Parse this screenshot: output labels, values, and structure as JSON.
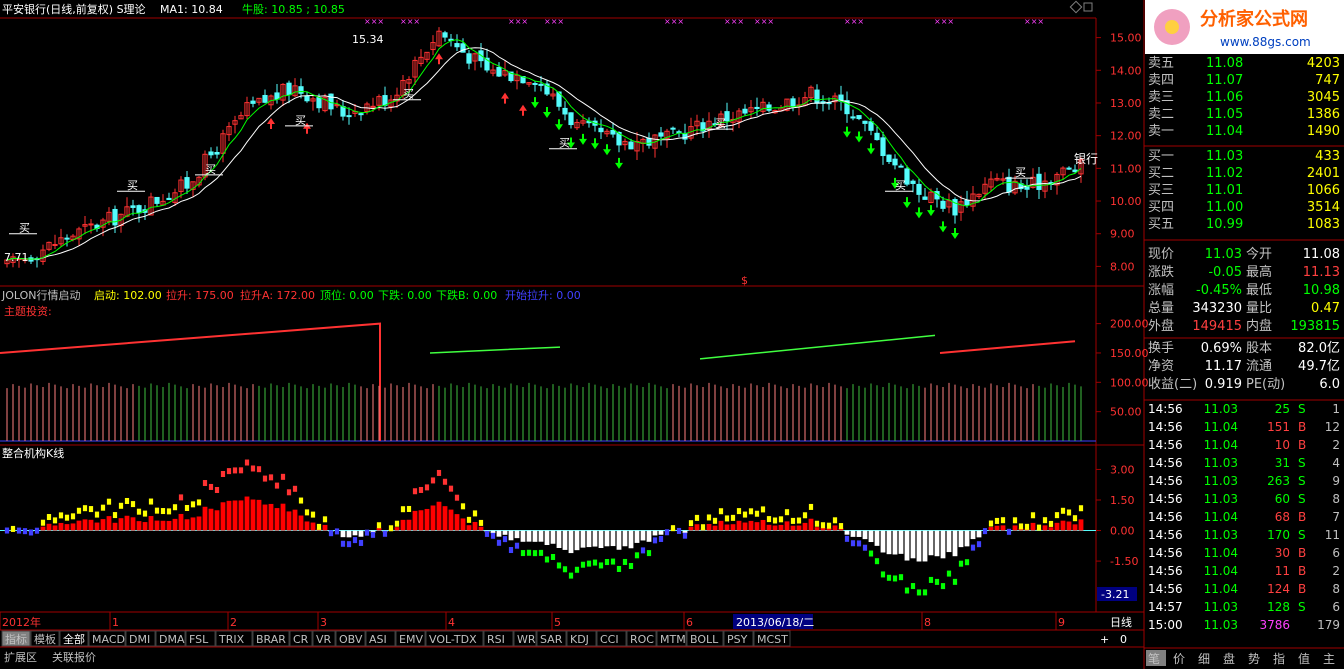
{
  "header": {
    "stock_title": "平安银行(日线,前复权) S理论",
    "ma1_label": "MA1: 10.84",
    "bull_label": "牛股: 10.85 ; 10.85"
  },
  "panel_main": {
    "yticks": [
      "15.00",
      "14.00",
      "13.00",
      "12.00",
      "11.00",
      "10.00",
      "9.00",
      "8.00"
    ],
    "high_mark": "15.34",
    "low_mark": "7.71",
    "buy_text": "买",
    "bank_label": "银行"
  },
  "panel_jolon": {
    "title": "JOLON行情启动",
    "start": "启动: 102.00",
    "rise": "拉升: 175.00",
    "riseA": "拉升A: 172.00",
    "top": "顶位: 0.00",
    "drop": "下跌: 0.00",
    "dropB": "下跌B: 0.00",
    "begin_rise": "开始拉升: 0.00",
    "theme": "主题投资:",
    "yticks": [
      "200.00",
      "150.00",
      "100.00",
      "50.00"
    ]
  },
  "panel_k": {
    "title": "整合机构K线",
    "yticks": [
      "3.00",
      "1.50",
      "0.00",
      "-1.50"
    ],
    "last_value": "-3.21"
  },
  "xaxis": {
    "labels": [
      "2012年",
      "1",
      "2",
      "3",
      "4",
      "5",
      "6",
      "8",
      "9"
    ],
    "date_marker": "2013/06/18/二",
    "period": "日线"
  },
  "tabs": [
    "指标",
    "模板",
    "全部",
    "MACD",
    "DMI",
    "DMA",
    "FSL",
    "TRIX",
    "BRAR",
    "CR",
    "VR",
    "OBV",
    "ASI",
    "EMV",
    "VOL-TDX",
    "RSI",
    "WR",
    "SAR",
    "KDJ",
    "CCI",
    "ROC",
    "MTM",
    "BOLL",
    "PSY",
    "MCST"
  ],
  "tabs2": [
    "扩展区",
    "关联报价"
  ],
  "controls": [
    "+",
    "0"
  ],
  "logo": {
    "title": "分析家公式网",
    "url": "www.88gs.com"
  },
  "order_book": [
    {
      "label": "卖五",
      "price": "11.08",
      "vol": "4203"
    },
    {
      "label": "卖四",
      "price": "11.07",
      "vol": "747"
    },
    {
      "label": "卖三",
      "price": "11.06",
      "vol": "3045"
    },
    {
      "label": "卖二",
      "price": "11.05",
      "vol": "1386"
    },
    {
      "label": "卖一",
      "price": "11.04",
      "vol": "1490"
    },
    {
      "label": "买一",
      "price": "11.03",
      "vol": "433"
    },
    {
      "label": "买二",
      "price": "11.02",
      "vol": "2401"
    },
    {
      "label": "买三",
      "price": "11.01",
      "vol": "1066"
    },
    {
      "label": "买四",
      "price": "11.00",
      "vol": "3514"
    },
    {
      "label": "买五",
      "price": "10.99",
      "vol": "1083"
    }
  ],
  "quote": [
    {
      "l1": "现价",
      "v1": "11.03",
      "c1": "#00ff00",
      "l2": "今开",
      "v2": "11.08",
      "c2": "#ffffff"
    },
    {
      "l1": "涨跌",
      "v1": "-0.05",
      "c1": "#00ff00",
      "l2": "最高",
      "v2": "11.13",
      "c2": "#ff4040"
    },
    {
      "l1": "涨幅",
      "v1": "-0.45%",
      "c1": "#00ff00",
      "l2": "最低",
      "v2": "10.98",
      "c2": "#00ff00"
    },
    {
      "l1": "总量",
      "v1": "343230",
      "c1": "#ffffff",
      "l2": "量比",
      "v2": "0.47",
      "c2": "#ffff00"
    },
    {
      "l1": "外盘",
      "v1": "149415",
      "c1": "#ff4040",
      "l2": "内盘",
      "v2": "193815",
      "c2": "#00ff00"
    },
    {
      "l1": "换手",
      "v1": "0.69%",
      "c1": "#ffffff",
      "l2": "股本",
      "v2": "82.0亿",
      "c2": "#ffffff"
    },
    {
      "l1": "净资",
      "v1": "11.17",
      "c1": "#ffffff",
      "l2": "流通",
      "v2": "49.7亿",
      "c2": "#ffffff"
    },
    {
      "l1": "收益(二)",
      "v1": "0.919",
      "c1": "#ffffff",
      "l2": "PE(动)",
      "v2": "6.0",
      "c2": "#ffffff"
    }
  ],
  "ticks": [
    {
      "t": "14:56",
      "p": "11.03",
      "v": "25",
      "s": "S",
      "n": "1"
    },
    {
      "t": "14:56",
      "p": "11.04",
      "v": "151",
      "s": "B",
      "n": "12"
    },
    {
      "t": "14:56",
      "p": "11.04",
      "v": "10",
      "s": "B",
      "n": "2"
    },
    {
      "t": "14:56",
      "p": "11.03",
      "v": "31",
      "s": "S",
      "n": "4"
    },
    {
      "t": "14:56",
      "p": "11.03",
      "v": "263",
      "s": "S",
      "n": "9"
    },
    {
      "t": "14:56",
      "p": "11.03",
      "v": "60",
      "s": "S",
      "n": "8"
    },
    {
      "t": "14:56",
      "p": "11.04",
      "v": "68",
      "s": "B",
      "n": "7"
    },
    {
      "t": "14:56",
      "p": "11.03",
      "v": "170",
      "s": "S",
      "n": "11"
    },
    {
      "t": "14:56",
      "p": "11.04",
      "v": "30",
      "s": "B",
      "n": "6"
    },
    {
      "t": "14:56",
      "p": "11.04",
      "v": "11",
      "s": "B",
      "n": "2"
    },
    {
      "t": "14:56",
      "p": "11.04",
      "v": "124",
      "s": "B",
      "n": "8"
    },
    {
      "t": "14:57",
      "p": "11.03",
      "v": "128",
      "s": "S",
      "n": "6"
    },
    {
      "t": "15:00",
      "p": "11.03",
      "v": "3786",
      "s": "",
      "n": "179"
    }
  ],
  "bottom_tabs": [
    "笔",
    "价",
    "细",
    "盘",
    "势",
    "指",
    "值",
    "主"
  ],
  "colors": {
    "up": "#ff3232",
    "down": "#54fcfc",
    "bull_green": "#00ff00",
    "ma_white": "#ffffff",
    "axis_red": "#a00000"
  }
}
